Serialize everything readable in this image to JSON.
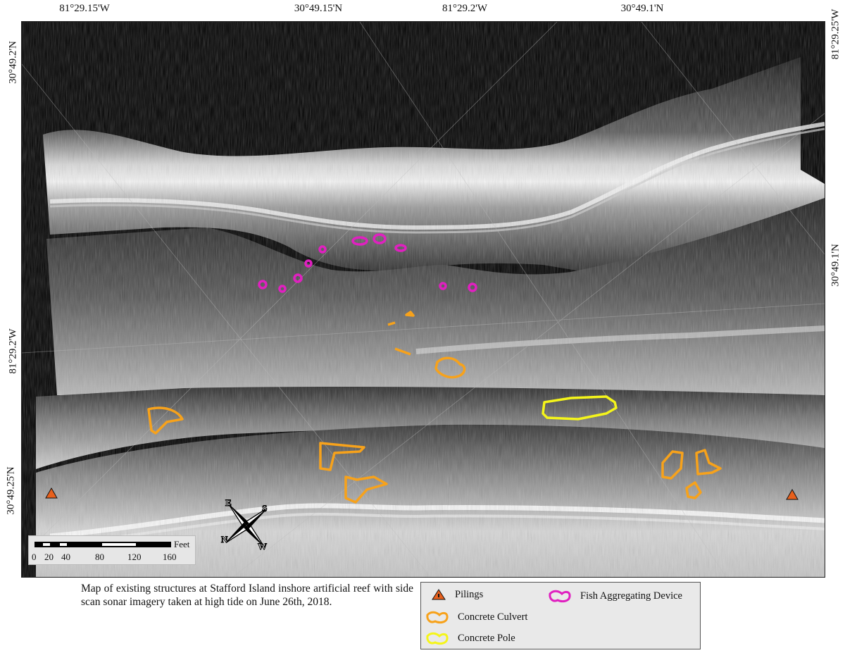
{
  "map": {
    "top_labels": [
      "81°29.15'W",
      "30°49.15'N",
      "81°29.2'W",
      "30°49.1'N"
    ],
    "left_labels": [
      "30°49.2'N",
      "81°29.2'W",
      "30°49.25'N"
    ],
    "right_labels": [
      "81°29.25'W",
      "30°49.1'N"
    ]
  },
  "scalebar": {
    "unit": "Feet",
    "ticks": [
      "0",
      "20",
      "40",
      "80",
      "120",
      "160"
    ]
  },
  "caption": "Map of existing structures at Stafford Island inshore artificial reef with side scan sonar imagery taken at high tide on June 26th, 2018.",
  "legend": {
    "items": [
      {
        "label": "Pilings",
        "color": "#e8601c",
        "icon": "triangle-icon"
      },
      {
        "label": "Concrete Culvert",
        "color": "#f7a21b",
        "icon": "polygon-icon"
      },
      {
        "label": "Concrete Pole",
        "color": "#f5f51a",
        "icon": "polygon-icon"
      },
      {
        "label": "Fish Aggregating Device",
        "color": "#e020c0",
        "icon": "polygon-icon"
      }
    ]
  },
  "compass": {
    "letters": [
      "E",
      "S",
      "N",
      "W"
    ]
  }
}
